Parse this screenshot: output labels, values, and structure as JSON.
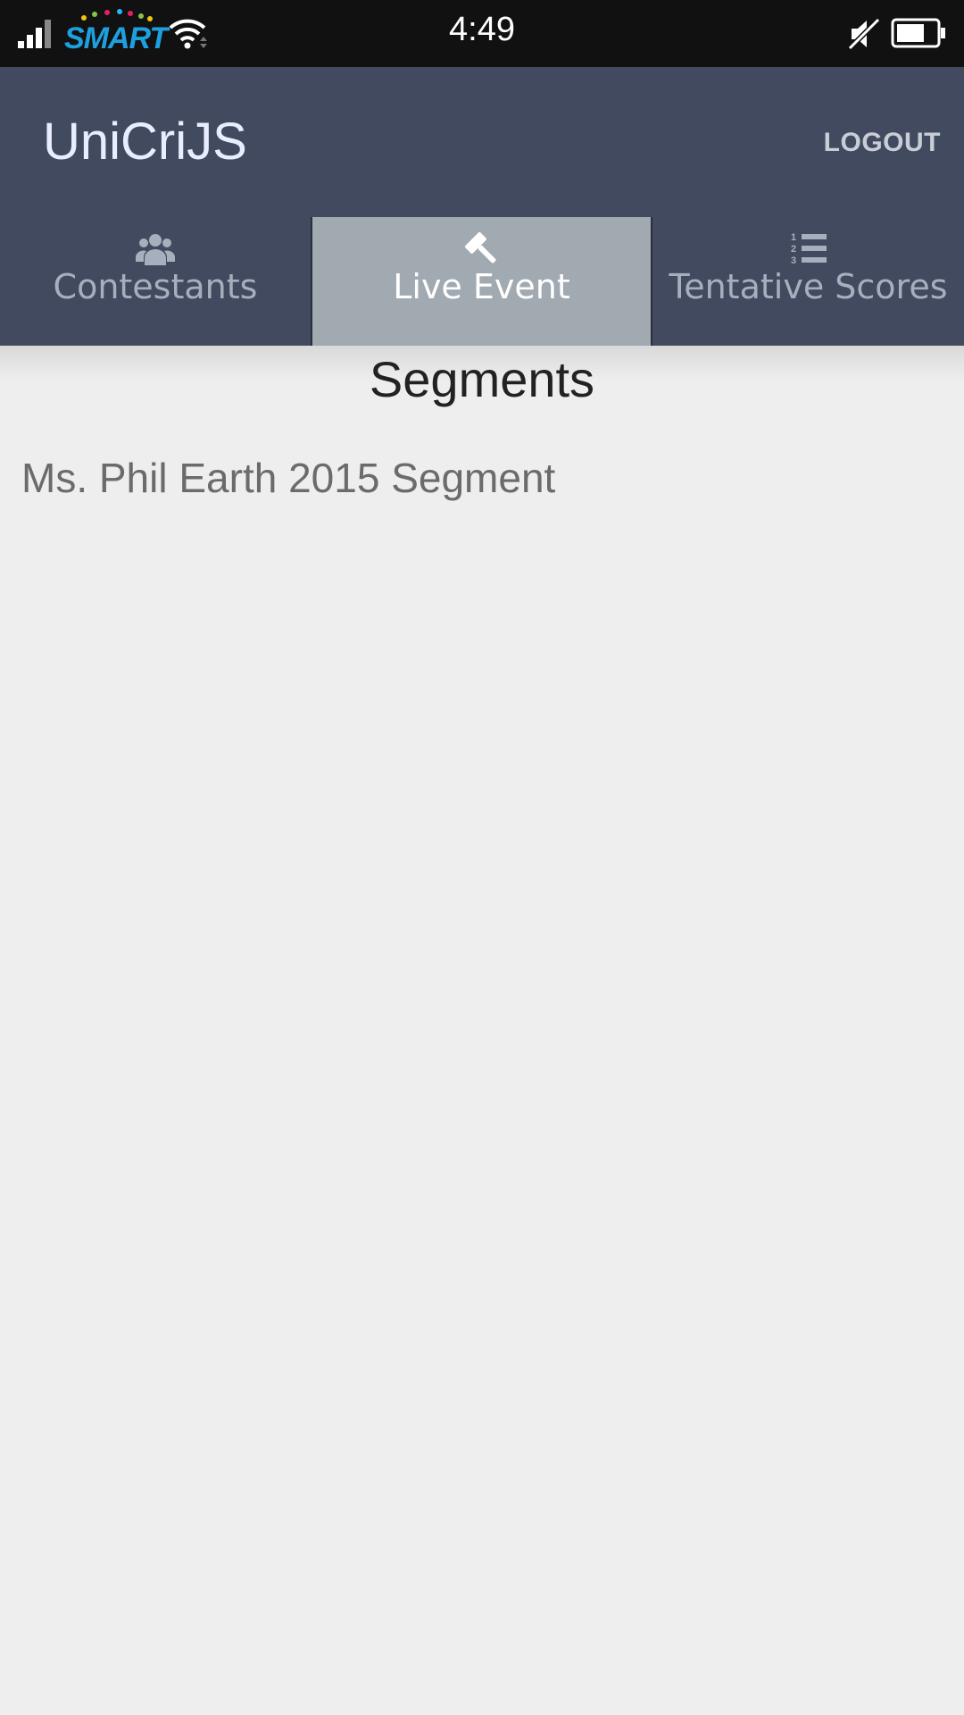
{
  "status_bar": {
    "carrier": "SMART",
    "time": "4:49",
    "icons": [
      "signal-icon",
      "wifi-icon",
      "mute-icon",
      "battery-icon"
    ]
  },
  "app_bar": {
    "title": "UniCriJS",
    "logout_label": "LOGOUT"
  },
  "tabs": [
    {
      "label": "Contestants",
      "icon": "users-icon",
      "active": false
    },
    {
      "label": "Live Event",
      "icon": "gavel-icon",
      "active": true
    },
    {
      "label": "Tentative Scores",
      "icon": "ordered-list-icon",
      "active": false
    }
  ],
  "main": {
    "section_title": "Segments",
    "segments": [
      "Ms. Phil Earth 2015 Segment"
    ]
  },
  "colors": {
    "app_bar": "#414a5f",
    "active_tab": "#a1a9b1",
    "background": "#eeeeee",
    "status_bar": "#111111"
  }
}
